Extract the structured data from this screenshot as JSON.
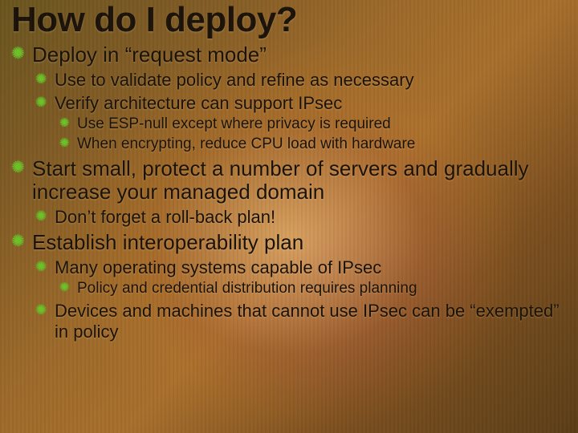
{
  "title": "How do I deploy?",
  "items": [
    {
      "text": "Deploy in “request mode”",
      "children": [
        {
          "text": "Use to validate policy and refine as necessary"
        },
        {
          "text": "Verify architecture can support IPsec",
          "children": [
            {
              "text": "Use ESP-null except where privacy is required"
            },
            {
              "text": "When encrypting, reduce CPU load with hardware"
            }
          ]
        }
      ]
    },
    {
      "text": "Start small, protect a number of servers and gradually increase your managed domain",
      "children": [
        {
          "text": "Don’t forget a roll-back plan!"
        }
      ]
    },
    {
      "text": "Establish interoperability plan",
      "children": [
        {
          "text": "Many operating systems capable of IPsec",
          "children": [
            {
              "text": "Policy and credential distribution requires planning"
            }
          ]
        },
        {
          "text": "Devices and machines that cannot use IPsec can be “exempted” in policy"
        }
      ]
    }
  ]
}
